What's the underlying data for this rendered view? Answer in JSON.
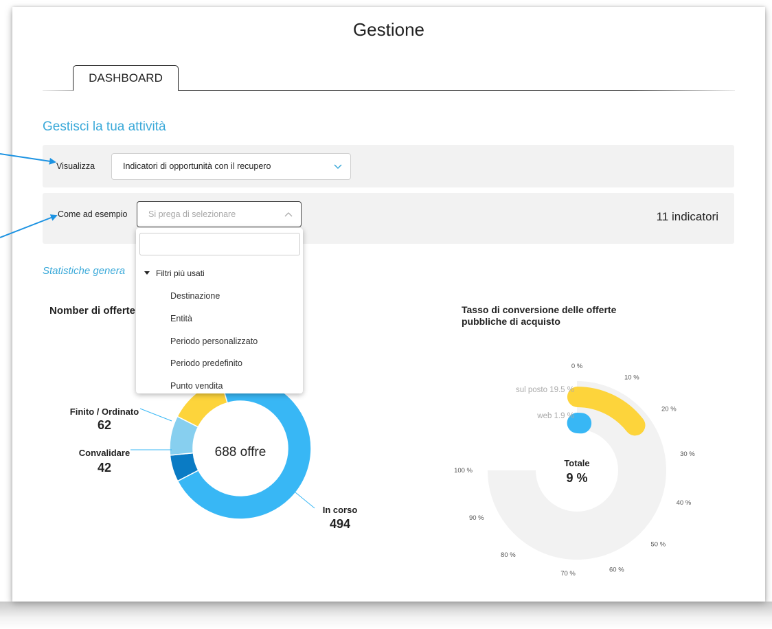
{
  "page": {
    "title": "Gestione"
  },
  "tabs": [
    {
      "label": "DASHBOARD",
      "active": true
    }
  ],
  "section": {
    "title": "Gestisci la tua attività"
  },
  "filters": {
    "view_label": "Visualizza",
    "view_value": "Indicatori di opportunità con il recupero",
    "example_label": "Come ad esempio",
    "example_placeholder": "Si prega di selezionare",
    "indicator_count": "11 indicatori"
  },
  "dropdown": {
    "search_value": "",
    "group_label": "Filtri più usati",
    "items": [
      "Destinazione",
      "Entità",
      "Periodo personalizzato",
      "Periodo predefinito",
      "Punto vendita"
    ]
  },
  "stats": {
    "title": "Statistiche genera"
  },
  "colors": {
    "accent": "#3aa9d9",
    "donut_in_corso": "#38b7f5",
    "donut_convalidare": "#0a7bc4",
    "donut_finito": "#87cfef",
    "donut_other": "#fdd43b",
    "gauge_track": "#f2f2f2",
    "gauge_yellow": "#fdd43b",
    "gauge_blue": "#38b7f5",
    "arrow": "#1d93e2"
  },
  "chart_data": [
    {
      "type": "pie",
      "title": "Nomber di offerte",
      "center_label": "688 offre",
      "total": 688,
      "slices": [
        {
          "label": "In corso",
          "value": 494
        },
        {
          "label": "Convalidare",
          "value": 42
        },
        {
          "label": "Finito / Ordinato",
          "value": 62
        },
        {
          "label": "",
          "value": 90
        }
      ]
    },
    {
      "type": "bar",
      "title": "Tasso di conversione delle offerte pubbliche di acquisto",
      "center_label": "Totale",
      "center_value": "9 %",
      "series": [
        {
          "name": "sul posto 19.5 %",
          "value": 19.5
        },
        {
          "name": "web 1.9 %",
          "value": 1.9
        }
      ],
      "axis_ticks": [
        "0 %",
        "10 %",
        "20 %",
        "30 %",
        "40 %",
        "50 %",
        "60 %",
        "70 %",
        "80 %",
        "90 %",
        "100 %"
      ],
      "ylim": [
        0,
        100
      ]
    }
  ]
}
